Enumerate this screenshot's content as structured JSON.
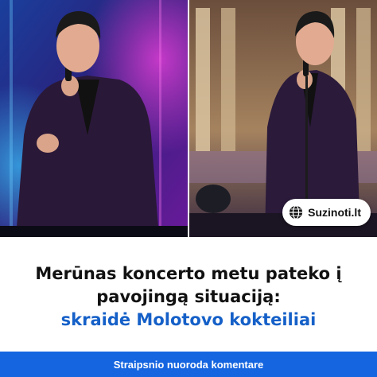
{
  "photos": [
    {
      "name": "concert-photo-left"
    },
    {
      "name": "concert-photo-right"
    }
  ],
  "brand": {
    "icon": "globe-icon",
    "label": "Suzinoti.lt"
  },
  "headline": {
    "line1": "Merūnas koncerto metu pateko į",
    "line2": "pavojingą situaciją:",
    "line3": "skraidė Molotovo kokteiliai"
  },
  "footer": {
    "label": "Straipsnio nuoroda komentare"
  },
  "colors": {
    "accent": "#1560c8",
    "footer_bg": "#1565e0",
    "headline": "#111111"
  }
}
